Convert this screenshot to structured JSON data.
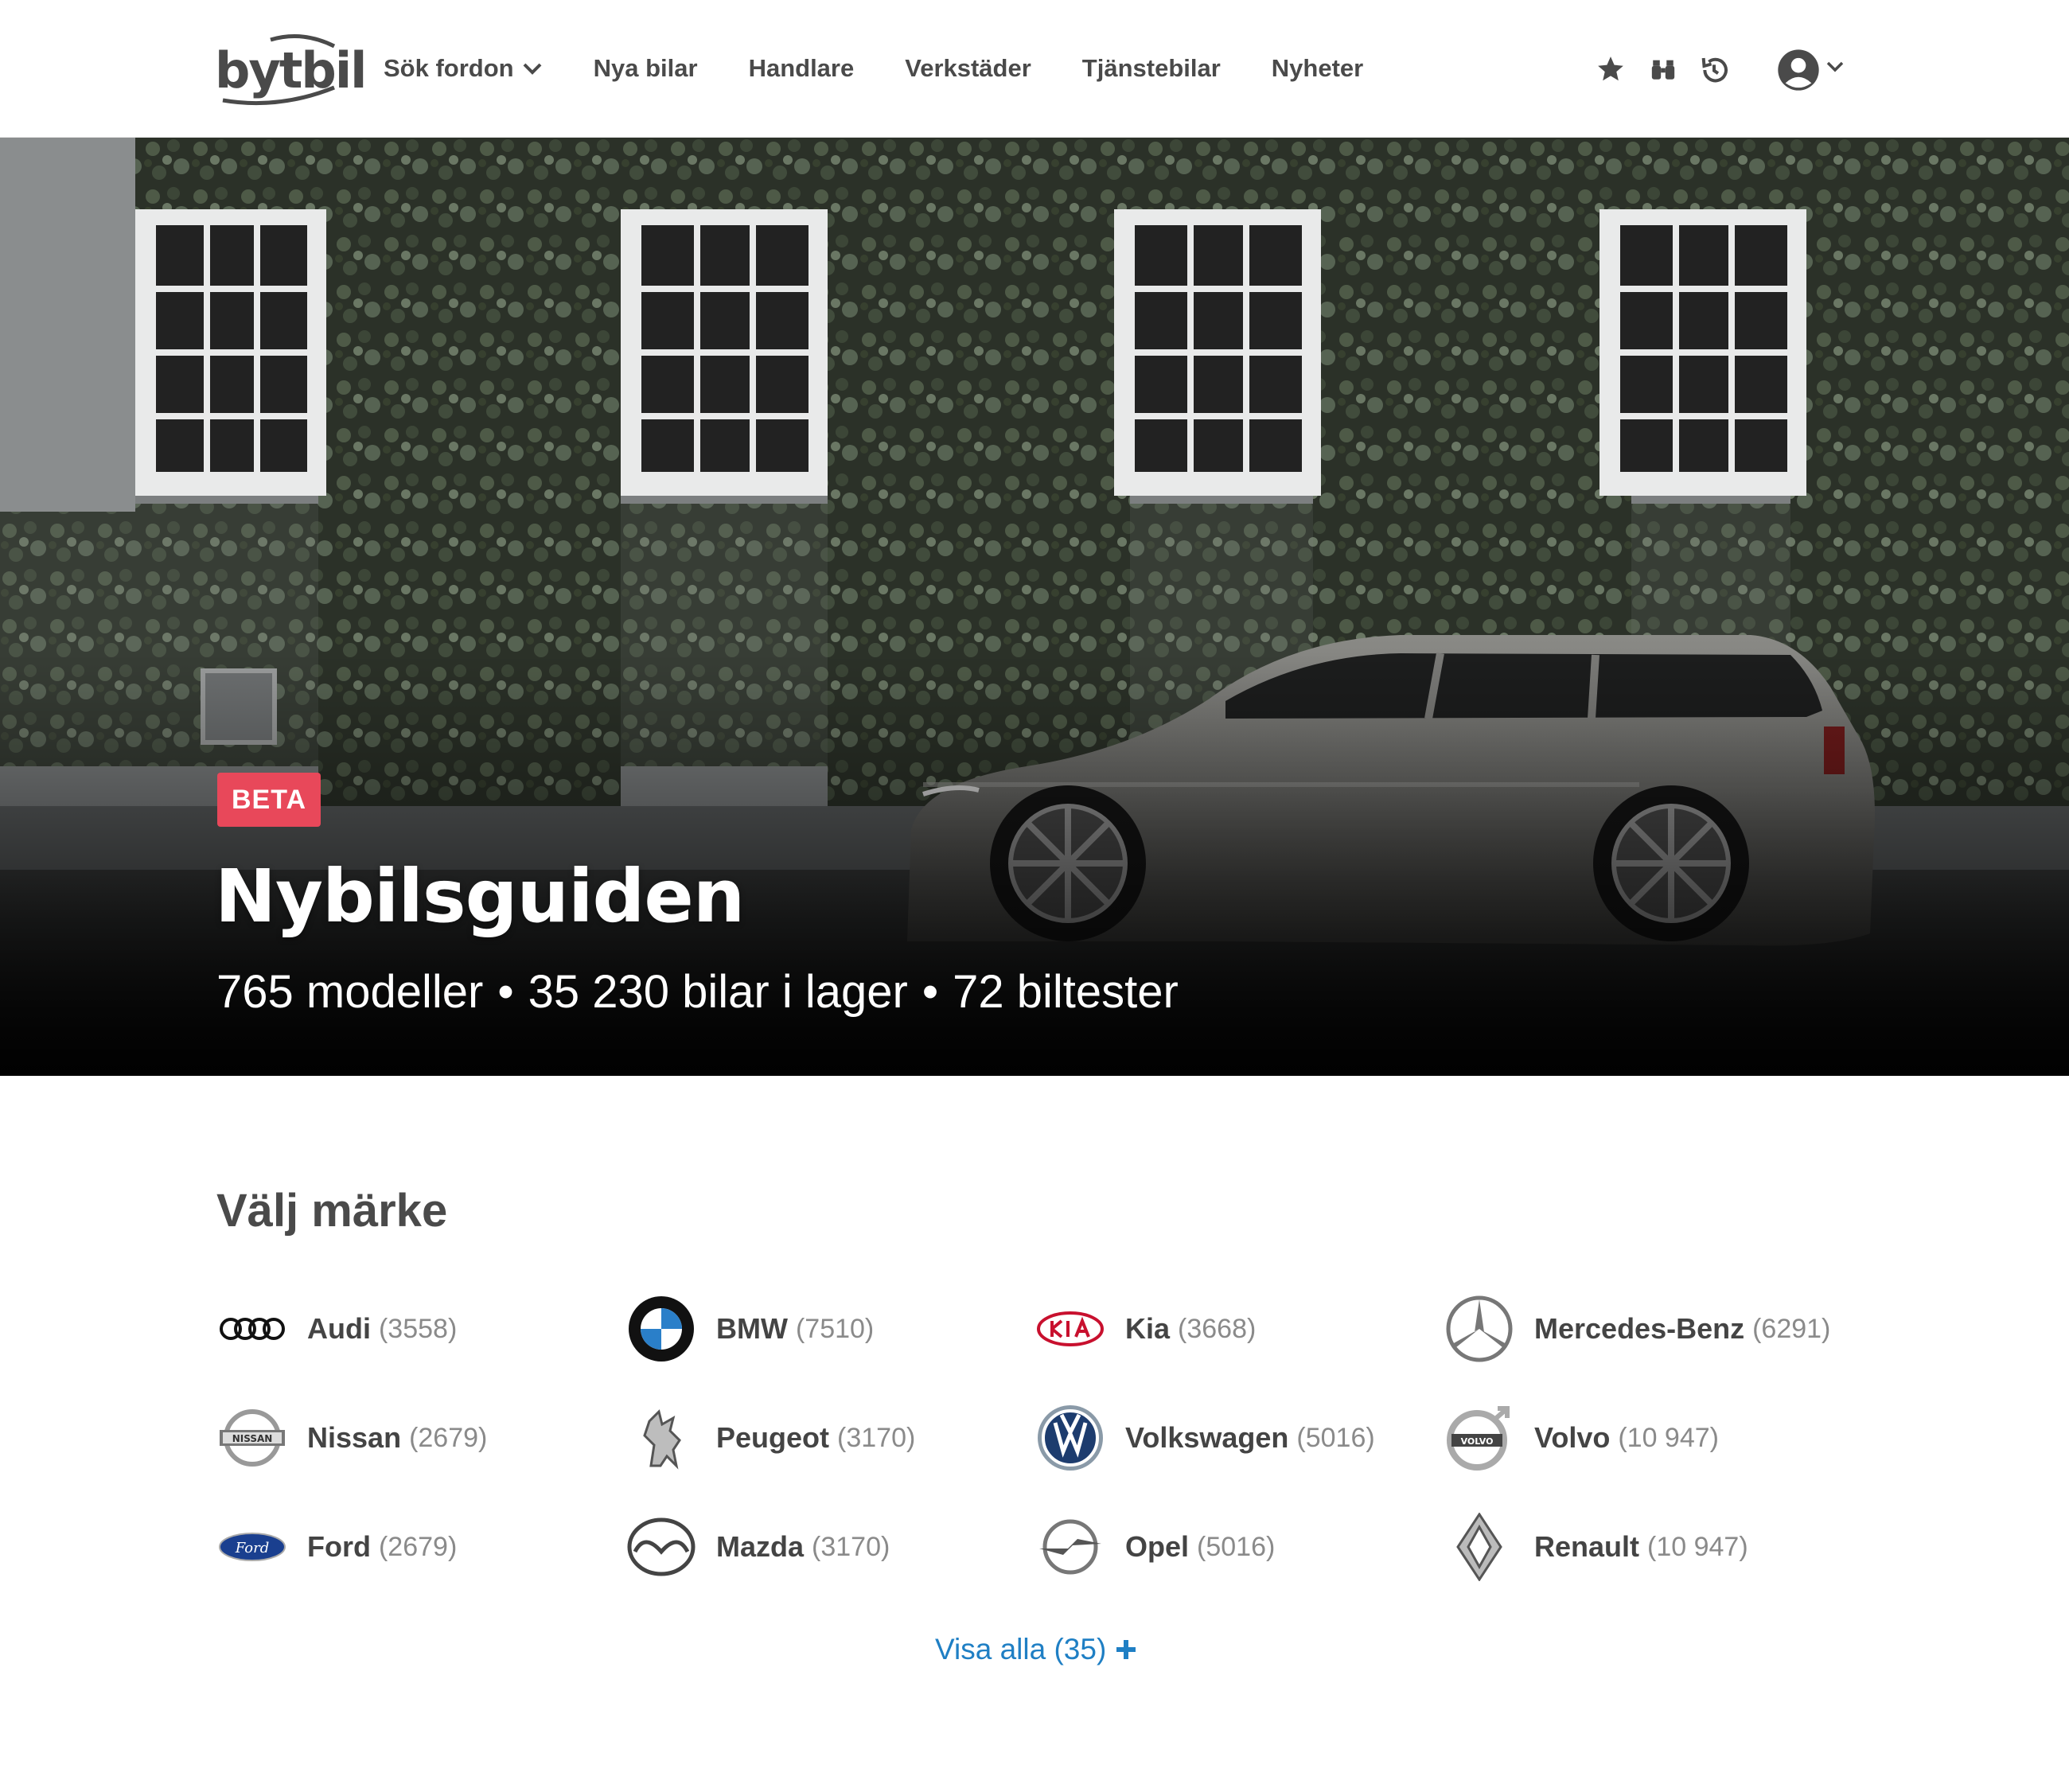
{
  "header": {
    "logo_text": "bytbil",
    "nav": [
      {
        "label": "Sök fordon",
        "has_dropdown": true
      },
      {
        "label": "Nya bilar"
      },
      {
        "label": "Handlare"
      },
      {
        "label": "Verkstäder"
      },
      {
        "label": "Tjänstebilar"
      },
      {
        "label": "Nyheter"
      }
    ],
    "icons": [
      "star-icon",
      "binoculars-icon",
      "history-icon",
      "account-icon",
      "chevron-down-icon"
    ]
  },
  "hero": {
    "badge": "BETA",
    "title": "Nybilsguiden",
    "stats": [
      "765 modeller",
      "35 230 bilar i lager",
      "72 biltester"
    ],
    "separator": "•"
  },
  "brands": {
    "title": "Välj märke",
    "items": [
      {
        "name": "Audi",
        "count": "(3558)",
        "icon": "audi-logo"
      },
      {
        "name": "BMW",
        "count": "(7510)",
        "icon": "bmw-logo"
      },
      {
        "name": "Kia",
        "count": "(3668)",
        "icon": "kia-logo"
      },
      {
        "name": "Mercedes-Benz",
        "count": "(6291)",
        "icon": "mercedes-logo"
      },
      {
        "name": "Nissan",
        "count": "(2679)",
        "icon": "nissan-logo"
      },
      {
        "name": "Peugeot",
        "count": "(3170)",
        "icon": "peugeot-logo"
      },
      {
        "name": "Volkswagen",
        "count": "(5016)",
        "icon": "volkswagen-logo"
      },
      {
        "name": "Volvo",
        "count": "(10 947)",
        "icon": "volvo-logo"
      },
      {
        "name": "Ford",
        "count": "(2679)",
        "icon": "ford-logo"
      },
      {
        "name": "Mazda",
        "count": "(3170)",
        "icon": "mazda-logo"
      },
      {
        "name": "Opel",
        "count": "(5016)",
        "icon": "opel-logo"
      },
      {
        "name": "Renault",
        "count": "(10 947)",
        "icon": "renault-logo"
      }
    ],
    "show_all": "Visa alla (35)"
  },
  "colors": {
    "badge": "#e8485a",
    "link": "#1f7fc4",
    "text": "#4a4a4a"
  }
}
